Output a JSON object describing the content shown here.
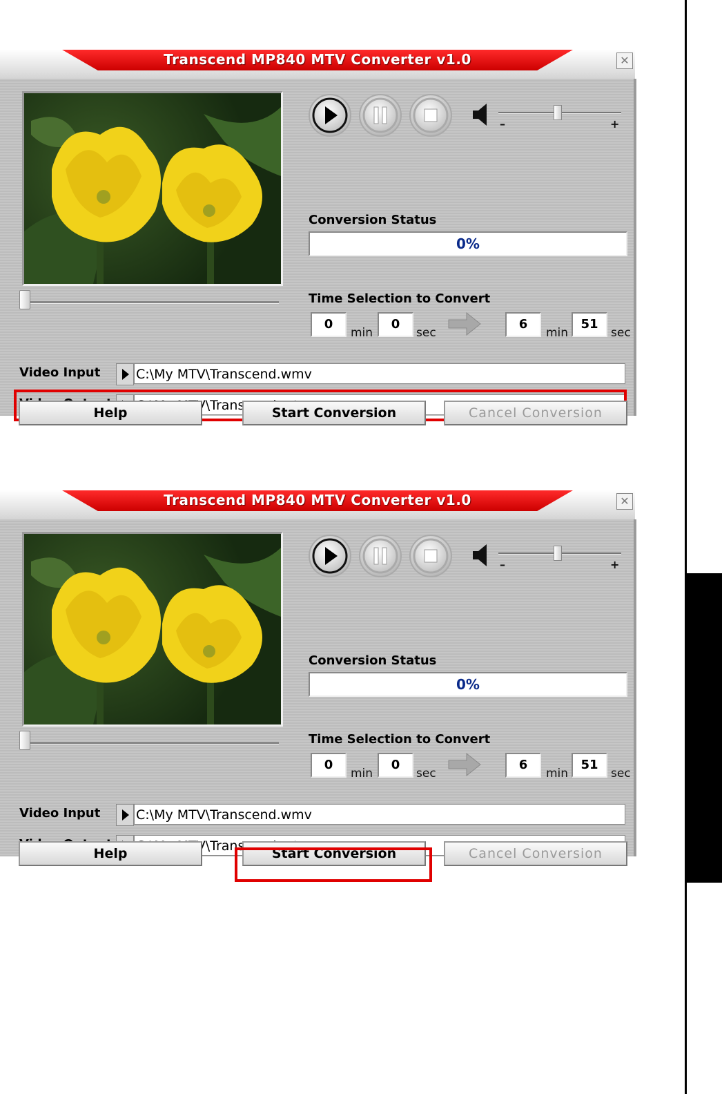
{
  "app": {
    "title": "Transcend MP840 MTV Converter v1.0",
    "close_glyph": "✕"
  },
  "colors": {
    "title_red": "#ff1a1a",
    "highlight": "#e00000",
    "progress_text": "#0a2a8a"
  },
  "controls": {
    "icons": [
      "play-icon",
      "pause-icon",
      "stop-icon",
      "speaker-icon"
    ],
    "volume_minus": "–",
    "volume_plus": "+"
  },
  "status": {
    "label": "Conversion Status",
    "progress_text": "0%",
    "progress": 0
  },
  "time_selection": {
    "label": "Time Selection to Convert",
    "start_min": "0",
    "start_sec": "0",
    "end_min": "6",
    "end_sec": "51",
    "min_unit": "min",
    "sec_unit": "sec"
  },
  "video_input": {
    "label": "Video Input",
    "path": "C:\\My MTV\\Transcend.wmv"
  },
  "video_output": {
    "label": "Video Output",
    "path": "C:\\My MTV\\Transcend.mtv"
  },
  "buttons": {
    "help": "Help",
    "start": "Start Conversion",
    "cancel": "Cancel Conversion"
  }
}
